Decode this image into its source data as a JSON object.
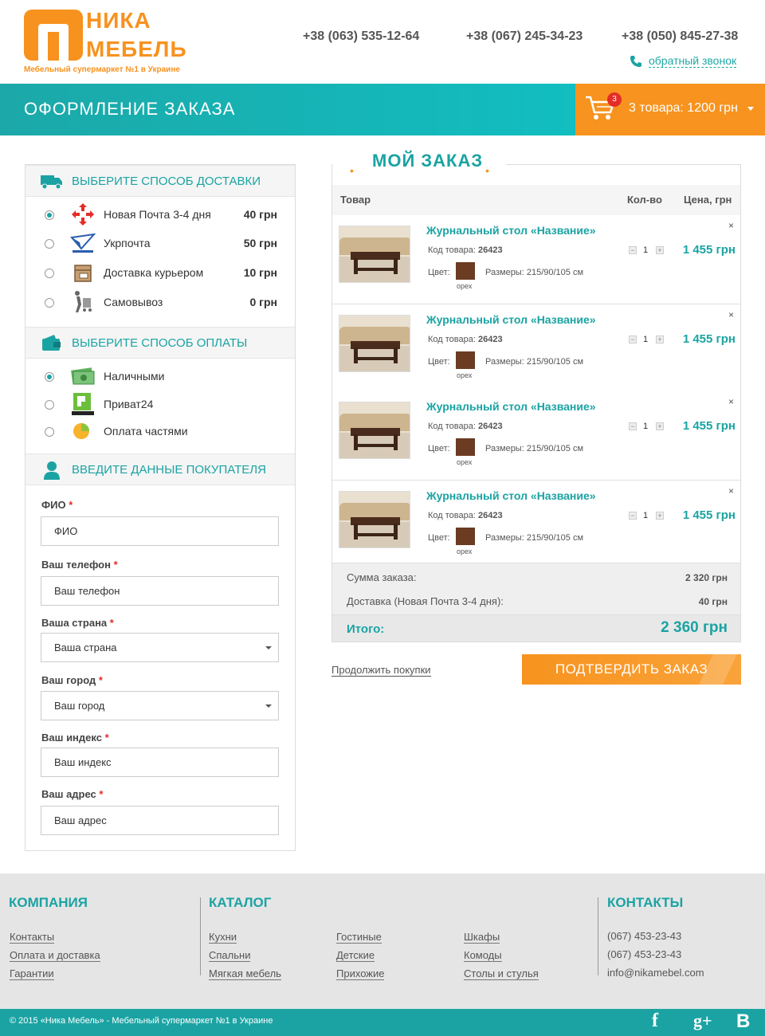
{
  "brand": {
    "name_line1": "НИКА",
    "name_line2": "МЕБЕЛЬ",
    "tagline": "Мебельный супермаркет №1 в Украине"
  },
  "header": {
    "phones": [
      "+38 (063) 535-12-64",
      "+38 (067) 245-34-23",
      "+38 (050) 845-27-38"
    ],
    "callback_label": "обратный звонок"
  },
  "page_title": "ОФОРМЛЕНИЕ ЗАКАЗА",
  "cart": {
    "badge": "3",
    "summary": "3 товара: 1200 грн"
  },
  "delivery": {
    "title": "ВЫБЕРИТЕ СПОСОБ ДОСТАВКИ",
    "options": [
      {
        "label": "Новая Почта 3-4 дня",
        "price": "40 грн",
        "selected": true,
        "icon": "nova-poshta-icon"
      },
      {
        "label": "Укрпочта",
        "price": "50 грн",
        "selected": false,
        "icon": "ukrposhta-icon"
      },
      {
        "label": "Доставка курьером",
        "price": "10 грн",
        "selected": false,
        "icon": "courier-box-icon"
      },
      {
        "label": "Самовывоз",
        "price": "0 грн",
        "selected": false,
        "icon": "pickup-cart-icon"
      }
    ]
  },
  "payment": {
    "title": "ВЫБЕРИТЕ СПОСОБ ОПЛАТЫ",
    "options": [
      {
        "label": "Наличными",
        "selected": true,
        "icon": "cash-icon"
      },
      {
        "label": "Приват24",
        "selected": false,
        "icon": "privat24-icon"
      },
      {
        "label": "Оплата частями",
        "selected": false,
        "icon": "installments-icon"
      }
    ]
  },
  "buyer": {
    "title": "ВВЕДИТЕ ДАННЫЕ ПОКУПАТЕЛЯ",
    "fields": [
      {
        "label": "ФИО",
        "placeholder": "ФИО",
        "type": "text"
      },
      {
        "label": "Ваш телефон",
        "placeholder": "Ваш телефон",
        "type": "text"
      },
      {
        "label": "Ваша страна",
        "placeholder": "Ваша страна",
        "type": "select"
      },
      {
        "label": "Ваш город",
        "placeholder": "Ваш город",
        "type": "select"
      },
      {
        "label": "Ваш индекс",
        "placeholder": "Ваш индекс",
        "type": "text"
      },
      {
        "label": "Ваш адрес",
        "placeholder": "Ваш адрес",
        "type": "text"
      }
    ],
    "required_mark": "*"
  },
  "order": {
    "title": "МОЙ ЗАКАЗ",
    "columns": {
      "product": "Товар",
      "qty": "Кол-во",
      "price": "Цена, грн"
    },
    "items": [
      {
        "name": "Журнальный стол «Название»",
        "code_label": "Код товара:",
        "code": "26423",
        "color_label": "Цвет:",
        "color_name": "орех",
        "size_label": "Размеры:",
        "size": "215/90/105 см",
        "qty": "1",
        "price": "1 455 грн",
        "remove": "×"
      },
      {
        "name": "Журнальный стол «Название»",
        "code_label": "Код товара:",
        "code": "26423",
        "color_label": "Цвет:",
        "color_name": "орех",
        "size_label": "Размеры:",
        "size": "215/90/105 см",
        "qty": "1",
        "price": "1 455 грн",
        "remove": "×"
      },
      {
        "name": "Журнальный стол «Название»",
        "code_label": "Код товара:",
        "code": "26423",
        "color_label": "Цвет:",
        "color_name": "орех",
        "size_label": "Размеры:",
        "size": "215/90/105 см",
        "qty": "1",
        "price": "1 455 грн",
        "remove": "×"
      },
      {
        "name": "Журнальный стол «Название»",
        "code_label": "Код товара:",
        "code": "26423",
        "color_label": "Цвет:",
        "color_name": "орех",
        "size_label": "Размеры:",
        "size": "215/90/105 см",
        "qty": "1",
        "price": "1 455 грн",
        "remove": "×"
      }
    ],
    "qty_minus": "−",
    "qty_plus": "+",
    "sum_label": "Сумма заказа:",
    "sum_value": "2 320 грн",
    "delivery_label": "Доставка (Новая Почта 3-4 дня):",
    "delivery_value": "40 грн",
    "total_label": "Итого:",
    "total_value": "2 360 грн"
  },
  "actions": {
    "continue": "Продолжить покупки",
    "confirm": "ПОДТВЕРДИТЬ ЗАКАЗ"
  },
  "footer": {
    "company": {
      "title": "КОМПАНИЯ",
      "links": [
        "Контакты",
        "Оплата и доставка",
        "Гарантии"
      ]
    },
    "catalog": {
      "title": "КАТАЛОГ",
      "links": [
        "Кухни",
        "Спальни",
        "Мягкая мебель",
        "Гостиные",
        "Детские",
        "Прихожие",
        "Шкафы",
        "Комоды",
        "Столы и стулья"
      ]
    },
    "contacts": {
      "title": "КОНТАКТЫ",
      "lines": [
        "(067) 453-23-43",
        "(067) 453-23-43",
        "info@nikamebel.com"
      ]
    },
    "copyright": "© 2015 «Ника Мебель» - Мебельный супермаркет №1 в Украине",
    "social": {
      "facebook": "f",
      "google": "g+",
      "vk": "B"
    }
  },
  "colors": {
    "teal": "#1ba3a3",
    "orange": "#f7931e",
    "red": "#e52d27"
  }
}
